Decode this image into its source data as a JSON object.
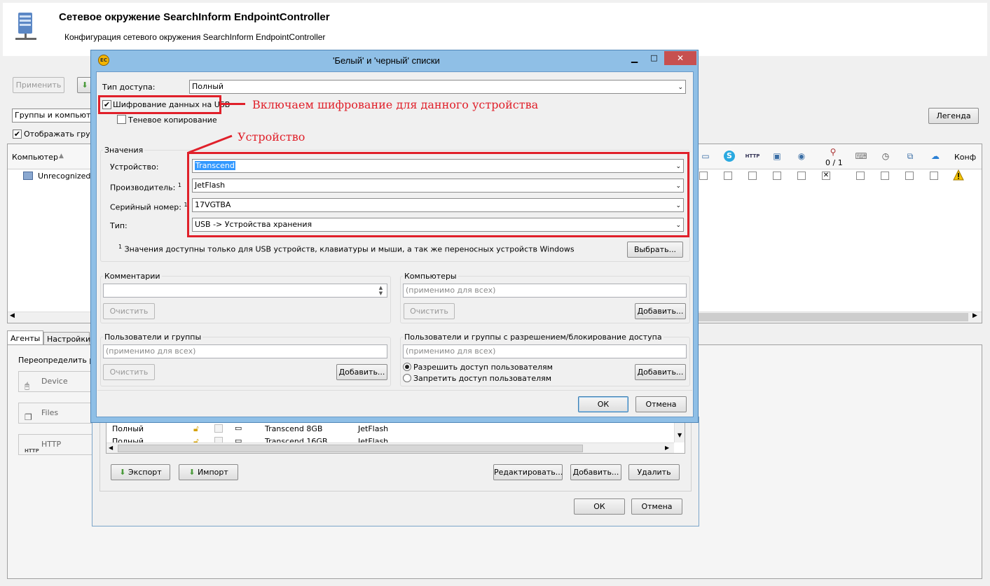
{
  "header": {
    "title": "Сетевое окружение SearchInform EndpointController",
    "subtitle": "Конфигурация сетевого окружения SearchInform EndpointController"
  },
  "toolbar": {
    "apply_label": "Применить"
  },
  "filter": {
    "groups_combo": "Группы и компьютер",
    "show_groups_label": "Отображать групп",
    "legend_label": "Легенда"
  },
  "grid": {
    "computer_col": "Компьютер",
    "conf_col": "Конф",
    "row1_name": "Unrecognized->",
    "counter": "0 / 1"
  },
  "bottom_tabs": {
    "agents": "Агенты",
    "settings": "Настройки"
  },
  "left_panel": {
    "override_label": "Переопределить ро",
    "device_label": "Device",
    "files_label": "Files",
    "http_label": "HTTP"
  },
  "back_dialog": {
    "rows": [
      {
        "access": "Полный",
        "device": "Transcend 8GB",
        "vendor": "JetFlash"
      },
      {
        "access": "Полный",
        "device": "Transcend 16GB",
        "vendor": "JetFlash"
      }
    ],
    "export_label": "Экспорт",
    "import_label": "Импорт",
    "edit_label": "Редактировать...",
    "add_label": "Добавить...",
    "delete_label": "Удалить",
    "ok_label": "ОК",
    "cancel_label": "Отмена"
  },
  "dialog": {
    "title": "'Белый' и 'черный' списки",
    "icon_text": "EC",
    "access_type_label": "Тип доступа:",
    "access_type_value": "Полный",
    "encrypt_label": "Шифрование данных на USB",
    "shadow_label": "Теневое копирование",
    "values_group": "Значения",
    "device_label": "Устройство:",
    "device_value": "Transcend",
    "vendor_label": "Производитель:",
    "vendor_value": "JetFlash",
    "serial_label": "Серийный номер:",
    "serial_value": "17VGTBA",
    "type_label": "Тип:",
    "type_value": "USB -> Устройства хранения",
    "footnote_mark": "1",
    "footnote": "Значения доступны только для USB устройств, клавиатуры и мыши, а так же переносных устройств Windows",
    "choose_label": "Выбрать...",
    "comments_group": "Комментарии",
    "computers_group": "Компьютеры",
    "computers_placeholder": "(применимо для всех)",
    "clear_label": "Очистить",
    "add_label": "Добавить...",
    "users_group": "Пользователи и группы",
    "users_placeholder": "(применимо для всех)",
    "users_perm_group": "Пользователи и группы с разрешением/блокирование доступа",
    "users_perm_placeholder": "(применимо для всех)",
    "allow_label": "Разрешить доступ пользователям",
    "deny_label": "Запретить доступ пользователям",
    "ok_label": "ОК",
    "cancel_label": "Отмена"
  },
  "annotations": {
    "encrypt_note": "Включаем шифрование для данного устройства",
    "device_note": "Устройство"
  }
}
